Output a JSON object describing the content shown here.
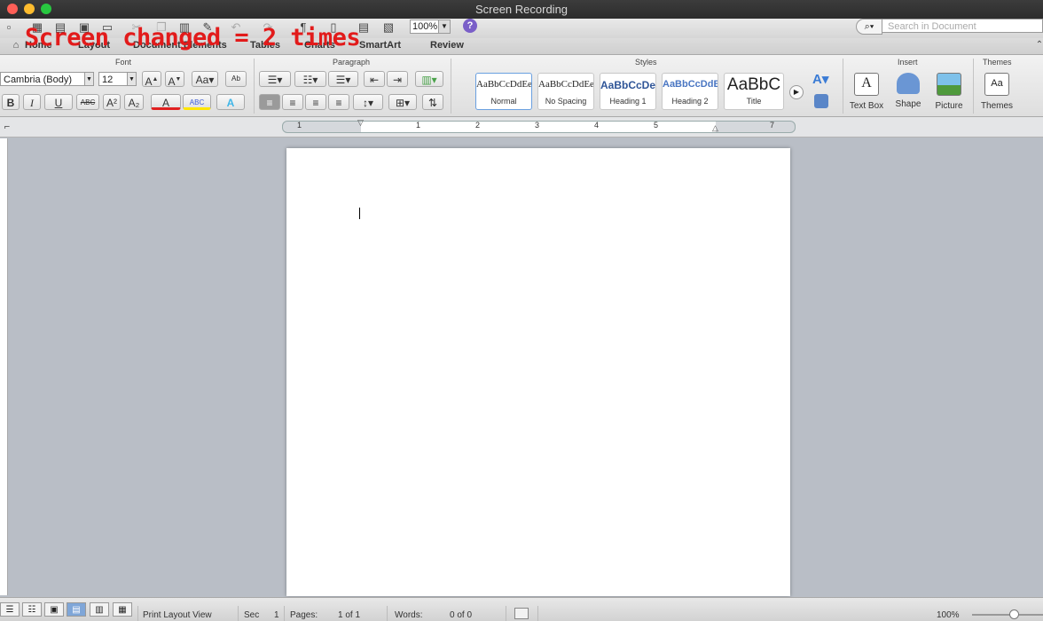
{
  "window": {
    "title": "Screen Recording"
  },
  "overlay_text": "Screen changed = 2 times",
  "toolbar": {
    "zoom": "100%",
    "search_placeholder": "Search in Document"
  },
  "tabs": [
    "Home",
    "Layout",
    "Document Elements",
    "Tables",
    "Charts",
    "SmartArt",
    "Review"
  ],
  "ribbon": {
    "groups": {
      "font": "Font",
      "paragraph": "Paragraph",
      "styles": "Styles",
      "insert": "Insert",
      "themes": "Themes"
    },
    "font_name": "Cambria (Body)",
    "font_size": "12",
    "styles": [
      {
        "sample": "AaBbCcDdEe",
        "name": "Normal"
      },
      {
        "sample": "AaBbCcDdEe",
        "name": "No Spacing"
      },
      {
        "sample": "AaBbCcDe",
        "name": "Heading 1"
      },
      {
        "sample": "AaBbCcDdEe",
        "name": "Heading 2"
      },
      {
        "sample": "AaBbC",
        "name": "Title"
      }
    ],
    "insert": {
      "text_box": "Text Box",
      "shape": "Shape",
      "picture": "Picture"
    },
    "themes_label": "Themes",
    "format_buttons": {
      "bold": "B",
      "italic": "I",
      "underline": "U",
      "strike": "ABC",
      "superscript": "A²",
      "subscript": "A₂",
      "font_color": "A",
      "highlight": "ABC",
      "text_effects": "A"
    }
  },
  "ruler": {
    "labels": [
      "1",
      "1",
      "2",
      "3",
      "4",
      "5",
      "7"
    ]
  },
  "statusbar": {
    "view": "Print Layout View",
    "sec_label": "Sec",
    "sec_value": "1",
    "pages_label": "Pages:",
    "pages_value": "1 of 1",
    "words_label": "Words:",
    "words_value": "0 of 0",
    "zoom": "100%"
  },
  "colors": {
    "titlebar": "#2e2e2e",
    "overlay": "#e21b1b",
    "help": "#7a5fc8",
    "font_color_bar": "#e02020",
    "highlight_bar": "#ffe600"
  },
  "icons": [
    "new-document-icon",
    "templates-icon",
    "open-icon",
    "save-icon",
    "print-icon",
    "cut-icon",
    "copy-icon",
    "paste-icon",
    "format-painter-icon",
    "undo-icon",
    "redo-icon",
    "show-formatting-icon",
    "sidebar-icon",
    "gallery-icon",
    "media-browser-icon",
    "help-icon",
    "search-icon"
  ]
}
